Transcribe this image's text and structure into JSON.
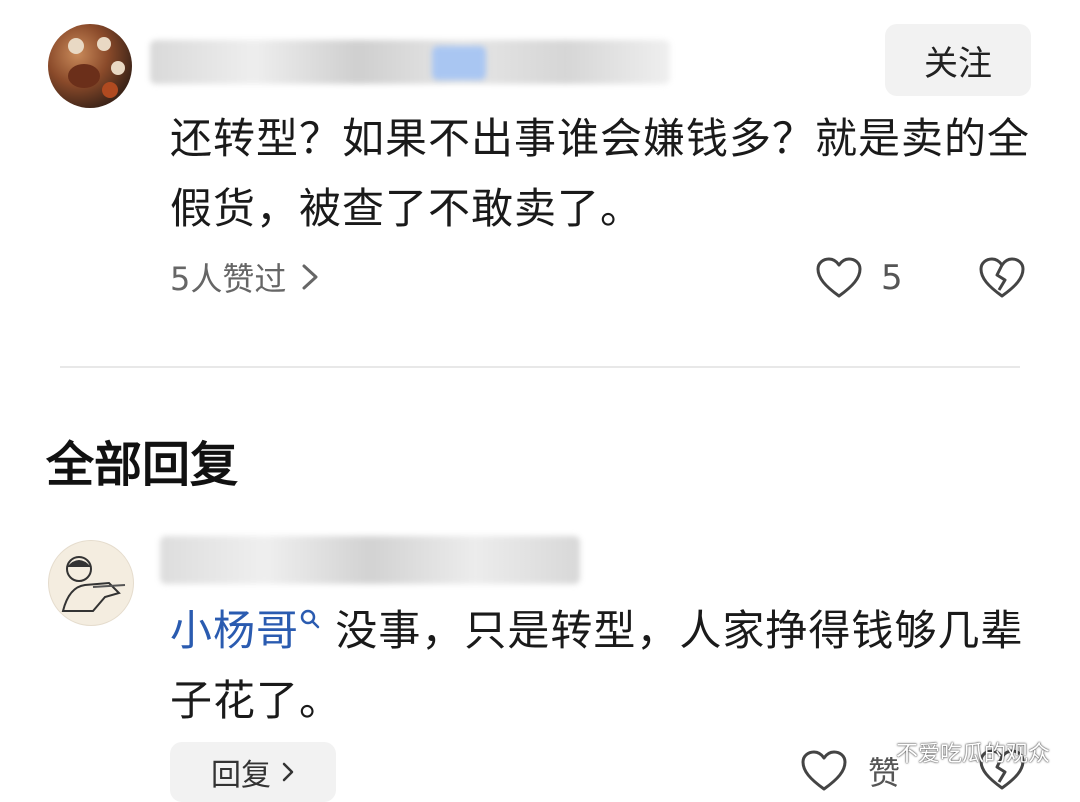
{
  "comment": {
    "follow_label": "关注",
    "text": "还转型？如果不出事谁会嫌钱多？就是卖的全假货，被查了不敢卖了。",
    "liked_by": "5人赞过",
    "like_count": "5"
  },
  "replies_section": {
    "title": "全部回复"
  },
  "reply": {
    "mention": "小杨哥",
    "text": " 没事，只是转型，人家挣得钱够几辈子花了。",
    "reply_button_label": "回复",
    "like_label": "赞"
  },
  "watermark": "不爱吃瓜的观众",
  "colors": {
    "mention": "#2a5bb0",
    "button_bg": "#f2f2f2",
    "divider": "#e8e8e8"
  }
}
